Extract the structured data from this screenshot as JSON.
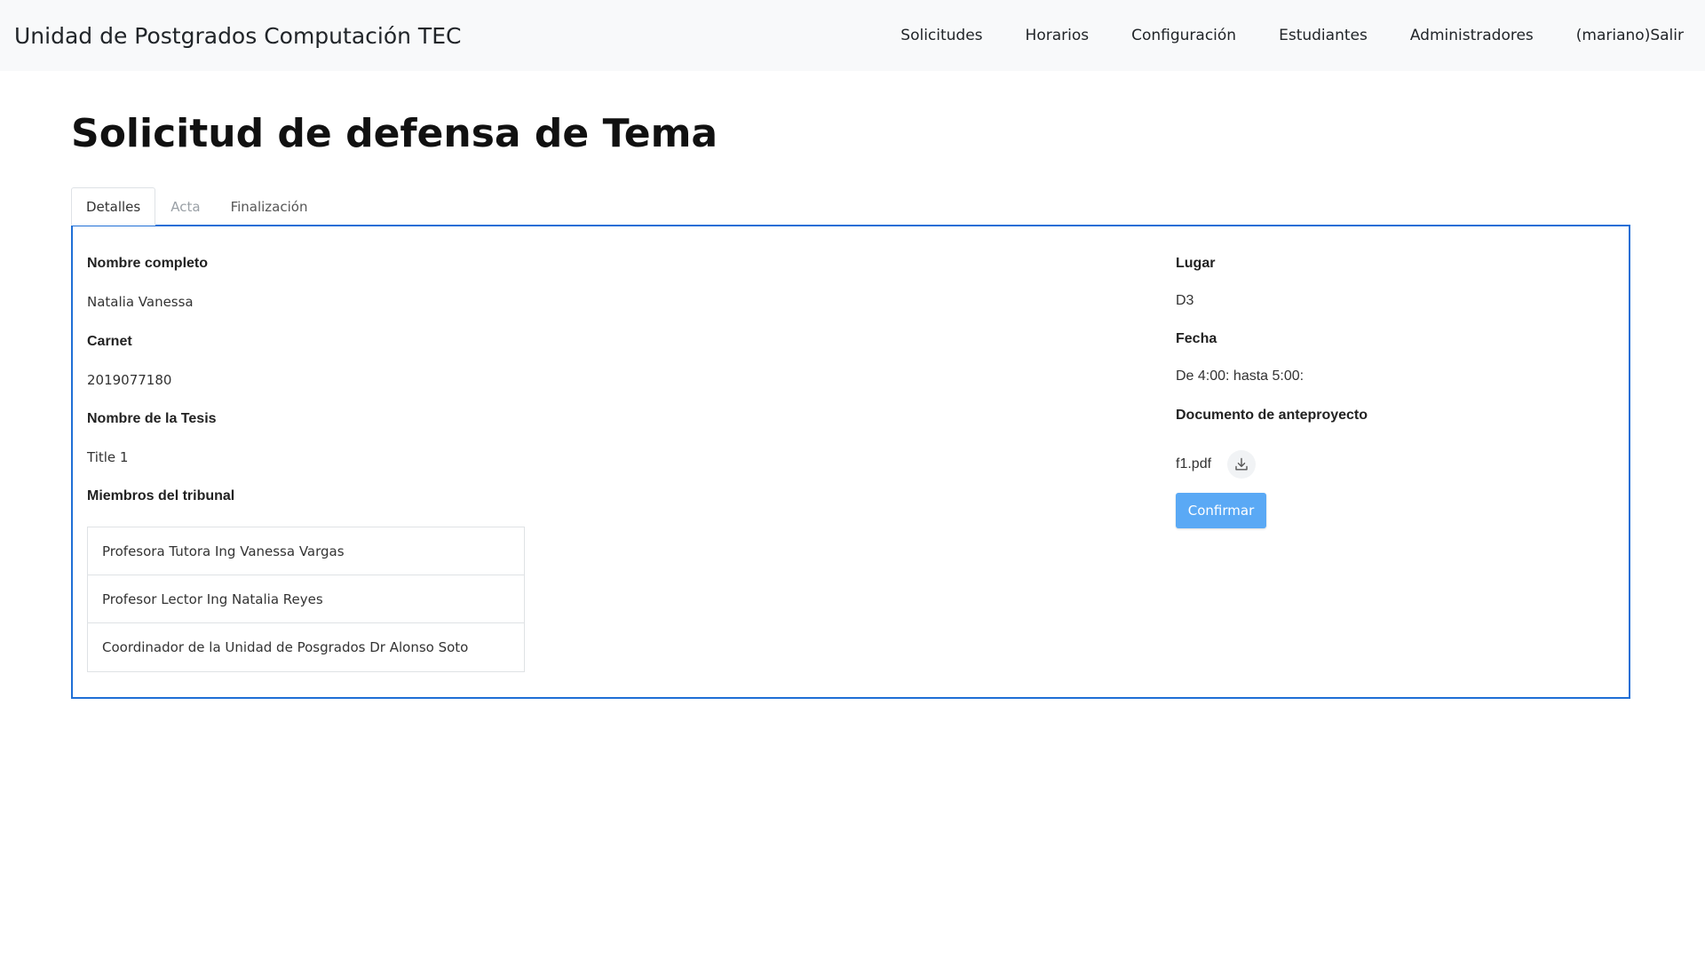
{
  "app": {
    "brand": "Unidad de Postgrados Computación TEC"
  },
  "nav": {
    "items": [
      {
        "label": "Solicitudes"
      },
      {
        "label": "Horarios"
      },
      {
        "label": "Configuración"
      },
      {
        "label": "Estudiantes"
      },
      {
        "label": "Administradores"
      },
      {
        "label": "(mariano)Salir"
      }
    ]
  },
  "page": {
    "title": "Solicitud de defensa de Tema"
  },
  "tabs": [
    {
      "label": "Detalles",
      "active": true
    },
    {
      "label": "Acta",
      "active": false
    },
    {
      "label": "Finalización",
      "active": false
    }
  ],
  "details": {
    "full_name_label": "Nombre completo",
    "full_name": "Natalia Vanessa",
    "carnet_label": "Carnet",
    "carnet": "2019077180",
    "thesis_label": "Nombre de la Tesis",
    "thesis": "Title 1",
    "tribunal_label": "Miembros del tribunal",
    "tribunal": [
      "Profesora Tutora Ing Vanessa Vargas",
      "Profesor Lector Ing Natalia Reyes",
      "Coordinador de la Unidad de Posgrados Dr Alonso Soto"
    ],
    "place_label": "Lugar",
    "place": "D3",
    "date_label": "Fecha",
    "date": "De 4:00: hasta 5:00:",
    "document_label": "Documento de anteproyecto",
    "document_name": "f1.pdf",
    "download_icon": "download-icon",
    "confirm_label": "Confirmar"
  },
  "colors": {
    "panel_border": "#1f6fd6",
    "confirm_button": "#5aa9f5",
    "navbar_bg": "#f8f9fa"
  }
}
